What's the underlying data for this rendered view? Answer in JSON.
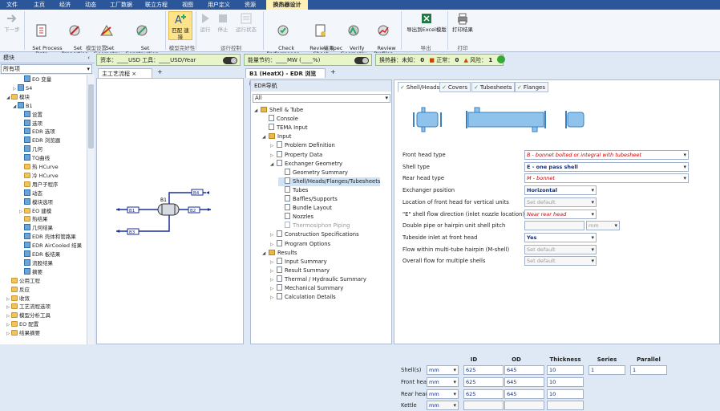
{
  "menu_tabs": [
    {
      "label": "文件"
    },
    {
      "label": "主页"
    },
    {
      "label": "经济"
    },
    {
      "label": "动态"
    },
    {
      "label": "工厂数据"
    },
    {
      "label": "联立方程"
    },
    {
      "label": "视图"
    },
    {
      "label": "用户定义"
    },
    {
      "label": "资源"
    },
    {
      "label": "换热器设计"
    }
  ],
  "ribbon": {
    "buttons": [
      {
        "label": "下一步"
      },
      {
        "label": "Set Process\nData"
      },
      {
        "label": "Set\nProperties"
      },
      {
        "label": "Set\nGeometry"
      },
      {
        "label": "Set\nConstruction"
      },
      {
        "label": "匹配 連接"
      },
      {
        "label": "运行"
      },
      {
        "label": "停止"
      },
      {
        "label": "运行状态"
      },
      {
        "label": "Check\nPerformance"
      },
      {
        "label": "Review Spec\nSheet"
      },
      {
        "label": "Verify\nGeometry"
      },
      {
        "label": "Review\nProfiles"
      },
      {
        "label": "导出到Excel模版"
      },
      {
        "label": "打印结果"
      }
    ],
    "groups": [
      "模型设置",
      "模型完好性",
      "运行控制",
      "结果",
      "导出",
      "打印"
    ]
  },
  "left_panel": {
    "title": "模块",
    "filter": "所有项",
    "tree": [
      {
        "label": "EO 变量",
        "indent": 3,
        "icon": "bico",
        "exp": ""
      },
      {
        "label": "S4",
        "indent": 2,
        "icon": "bico",
        "exp": "▷"
      },
      {
        "label": "模块",
        "indent": 1,
        "icon": "fico",
        "exp": "◢"
      },
      {
        "label": "B1",
        "indent": 2,
        "icon": "bico",
        "exp": "◢"
      },
      {
        "label": "设置",
        "indent": 3,
        "icon": "bico",
        "exp": ""
      },
      {
        "label": "选项",
        "indent": 3,
        "icon": "bico",
        "exp": ""
      },
      {
        "label": "EDR 选项",
        "indent": 3,
        "icon": "bico",
        "exp": ""
      },
      {
        "label": "EDR 浏览器",
        "indent": 3,
        "icon": "bico",
        "exp": ""
      },
      {
        "label": "几何",
        "indent": 3,
        "icon": "bico",
        "exp": ""
      },
      {
        "label": "TQ曲线",
        "indent": 3,
        "icon": "bico",
        "exp": ""
      },
      {
        "label": "热 HCurve",
        "indent": 3,
        "icon": "fico",
        "exp": ""
      },
      {
        "label": "冷 HCurve",
        "indent": 3,
        "icon": "fico",
        "exp": ""
      },
      {
        "label": "用户子程序",
        "indent": 3,
        "icon": "fico",
        "exp": ""
      },
      {
        "label": "动态",
        "indent": 3,
        "icon": "bico",
        "exp": ""
      },
      {
        "label": "模块选项",
        "indent": 3,
        "icon": "bico",
        "exp": ""
      },
      {
        "label": "EO 建模",
        "indent": 3,
        "icon": "fico",
        "exp": "▷"
      },
      {
        "label": "热结果",
        "indent": 3,
        "icon": "fico",
        "exp": ""
      },
      {
        "label": "几何结果",
        "indent": 3,
        "icon": "bico",
        "exp": ""
      },
      {
        "label": "EDR 壳体和管路果",
        "indent": 3,
        "icon": "bico",
        "exp": ""
      },
      {
        "label": "EDR AirCooled 结果",
        "indent": 3,
        "icon": "bico",
        "exp": ""
      },
      {
        "label": "EDR 板结果",
        "indent": 3,
        "icon": "bico",
        "exp": ""
      },
      {
        "label": "流股结果",
        "indent": 3,
        "icon": "bico",
        "exp": ""
      },
      {
        "label": "摘要",
        "indent": 3,
        "icon": "bico",
        "exp": ""
      },
      {
        "label": "公用工程",
        "indent": 1,
        "icon": "fico",
        "exp": ""
      },
      {
        "label": "反应",
        "indent": 1,
        "icon": "fico",
        "exp": ""
      },
      {
        "label": "收敛",
        "indent": 1,
        "icon": "fico",
        "exp": "▷"
      },
      {
        "label": "工艺流程选项",
        "indent": 1,
        "icon": "fico",
        "exp": "▷"
      },
      {
        "label": "模型分析工具",
        "indent": 1,
        "icon": "fico",
        "exp": "▷"
      },
      {
        "label": "EO 配置",
        "indent": 1,
        "icon": "fico",
        "exp": "▷"
      },
      {
        "label": "结果摘要",
        "indent": 1,
        "icon": "fico",
        "exp": "▷"
      }
    ]
  },
  "status": {
    "cost": "资本：____USD  工具：____USD/Year",
    "energy": "能量节约：____MW   (____%)",
    "hx": "换热器：未知：",
    "unknown": "0",
    "ok_label": "正常：",
    "ok": "0",
    "risk_label": "风险：",
    "risk": "1"
  },
  "doc_tabs": {
    "flowsheet": "主工艺流程",
    "edr": "B1 (HeatX) - EDR 浏览器"
  },
  "flowsheet": {
    "block": "B1",
    "streams": [
      "B4",
      "B1",
      "B2",
      "B3"
    ]
  },
  "nav": {
    "title": "EDR导航",
    "filter": "All",
    "items": [
      {
        "label": "Shell & Tube",
        "indent": 0,
        "icon": "folder",
        "exp": "◢"
      },
      {
        "label": "Console",
        "indent": 1,
        "icon": "page",
        "exp": ""
      },
      {
        "label": "TEMA Input",
        "indent": 1,
        "icon": "page",
        "exp": ""
      },
      {
        "label": "Input",
        "indent": 1,
        "icon": "folder",
        "exp": "◢"
      },
      {
        "label": "Problem Definition",
        "indent": 2,
        "icon": "page",
        "exp": "▷"
      },
      {
        "label": "Property Data",
        "indent": 2,
        "icon": "page",
        "exp": "▷"
      },
      {
        "label": "Exchanger Geometry",
        "indent": 2,
        "icon": "page",
        "exp": "◢"
      },
      {
        "label": "Geometry Summary",
        "indent": 3,
        "icon": "page",
        "exp": ""
      },
      {
        "label": "Shell/Heads/Flanges/Tubesheets",
        "indent": 3,
        "icon": "page",
        "exp": "",
        "sel": true
      },
      {
        "label": "Tubes",
        "indent": 3,
        "icon": "page",
        "exp": ""
      },
      {
        "label": "Baffles/Supports",
        "indent": 3,
        "icon": "page",
        "exp": ""
      },
      {
        "label": "Bundle Layout",
        "indent": 3,
        "icon": "page",
        "exp": ""
      },
      {
        "label": "Nozzles",
        "indent": 3,
        "icon": "page",
        "exp": ""
      },
      {
        "label": "Thermosiphon Piping",
        "indent": 3,
        "icon": "page",
        "exp": "",
        "gray": true
      },
      {
        "label": "Construction Specifications",
        "indent": 2,
        "icon": "page",
        "exp": "▷"
      },
      {
        "label": "Program Options",
        "indent": 2,
        "icon": "page",
        "exp": "▷"
      },
      {
        "label": "Results",
        "indent": 1,
        "icon": "folder",
        "exp": "◢"
      },
      {
        "label": "Input Summary",
        "indent": 2,
        "icon": "page",
        "exp": "▷"
      },
      {
        "label": "Result Summary",
        "indent": 2,
        "icon": "page",
        "exp": "▷"
      },
      {
        "label": "Thermal / Hydraulic Summary",
        "indent": 2,
        "icon": "page",
        "exp": "▷"
      },
      {
        "label": "Mechanical Summary",
        "indent": 2,
        "icon": "page",
        "exp": "▷"
      },
      {
        "label": "Calculation Details",
        "indent": 2,
        "icon": "page",
        "exp": "▷"
      }
    ]
  },
  "main_tabs": [
    "Shell/Heads",
    "Covers",
    "Tubesheets",
    "Flanges"
  ],
  "form": {
    "rows": [
      {
        "label": "Front head type",
        "value": "B - bonnet bolted or integral with tubesheet",
        "style": "",
        "w": "long"
      },
      {
        "label": "Shell type",
        "value": "E - one pass shell",
        "style": "bold",
        "w": "long"
      },
      {
        "label": "Rear head type",
        "value": "M - bonnet",
        "style": "",
        "w": "long"
      },
      {
        "label": "Exchanger position",
        "value": "Horizontal",
        "style": "bold",
        "w": "short"
      },
      {
        "label": "Location of front head for vertical units",
        "value": "Set default",
        "style": "gray",
        "w": "short"
      },
      {
        "label": "\"E\" shell flow direction (inlet nozzle location)",
        "value": "Near rear head",
        "style": "",
        "w": "short"
      },
      {
        "label": "Double pipe or hairpin unit shell pitch",
        "value": "",
        "style": "gray",
        "w": "pitch",
        "unit": "mm"
      },
      {
        "label": "Tubeside inlet at front head",
        "value": "Yes",
        "style": "bold",
        "w": "short"
      },
      {
        "label": "Flow within multi-tube hairpin (M-shell)",
        "value": "Set default",
        "style": "gray",
        "w": "short"
      },
      {
        "label": "Overall flow for multiple shells",
        "value": "Set default",
        "style": "gray",
        "w": "short"
      }
    ],
    "grid_headers": [
      "ID",
      "OD",
      "Thickness",
      "Series",
      "Parallel"
    ],
    "grid": [
      {
        "label": "Shell(s)",
        "unit": "mm",
        "id": "625",
        "od": "645",
        "th": "10",
        "series": "1",
        "parallel": "1"
      },
      {
        "label": "Front head",
        "unit": "mm",
        "id": "625",
        "od": "645",
        "th": "10"
      },
      {
        "label": "Rear head",
        "unit": "mm",
        "id": "625",
        "od": "645",
        "th": "10"
      },
      {
        "label": "Kettle",
        "unit": "mm",
        "id": "",
        "od": "",
        "th": ""
      }
    ]
  }
}
